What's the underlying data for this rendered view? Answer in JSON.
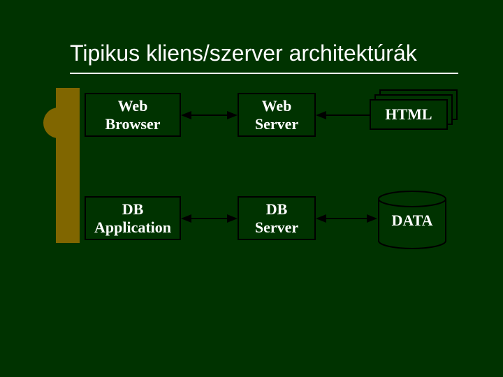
{
  "title": "Tipikus kliens/szerver architektúrák",
  "row1": {
    "client": {
      "line1": "Web",
      "line2": "Browser"
    },
    "server": {
      "line1": "Web",
      "line2": "Server"
    },
    "resource": "HTML"
  },
  "row2": {
    "client": {
      "line1": "DB",
      "line2": "Application"
    },
    "server": {
      "line1": "DB",
      "line2": "Server"
    },
    "resource": "DATA"
  }
}
